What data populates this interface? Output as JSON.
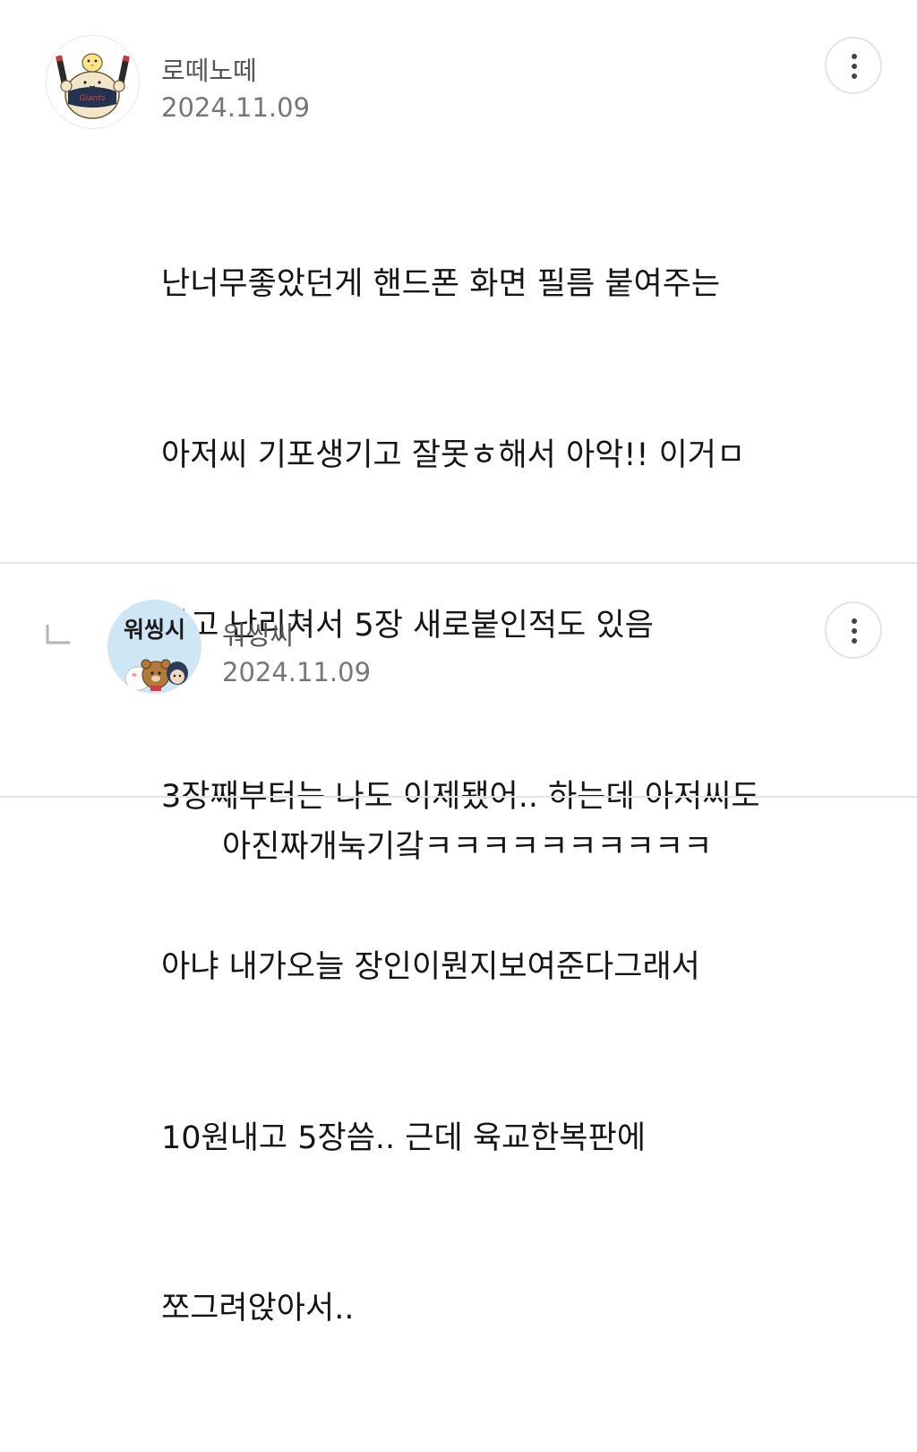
{
  "comments": [
    {
      "username": "로떼노떼",
      "date": "2024.11.09",
      "avatar_icon": "giants-bear-mascot-avatar-icon",
      "lines": [
        "난너무좋았던게 핸드폰 화면 필름 붙여주는",
        "아저씨 기포생기고 잘못ㅎ해서 아악!! 이거ㅁ",
        "냐고 난리쳐서 5장 새로붙인적도 있음",
        "3장째부터는 나도 이제됐어.. 하는데 아저씨도",
        "아냐 내가오늘 장인이뭔지보여준다그래서",
        "10원내고 5장씀.. 근데 육교한복판에",
        "쪼그려앉아서.."
      ]
    },
    {
      "username": "워씽씨",
      "date": "2024.11.09",
      "avatar_text": "워씽시",
      "avatar_icon": "kakao-characters-avatar-icon",
      "is_reply": true,
      "lines": [
        "아진짜개눅기갘ㅋㅋㅋㅋㅋㅋㅋㅋㅋㅋ"
      ]
    }
  ],
  "icons": {
    "more": "more-vertical-icon",
    "reply": "reply-arrow-icon"
  },
  "colors": {
    "divider": "#e3e3e3",
    "avatar2_bg": "#cfe6f5"
  }
}
